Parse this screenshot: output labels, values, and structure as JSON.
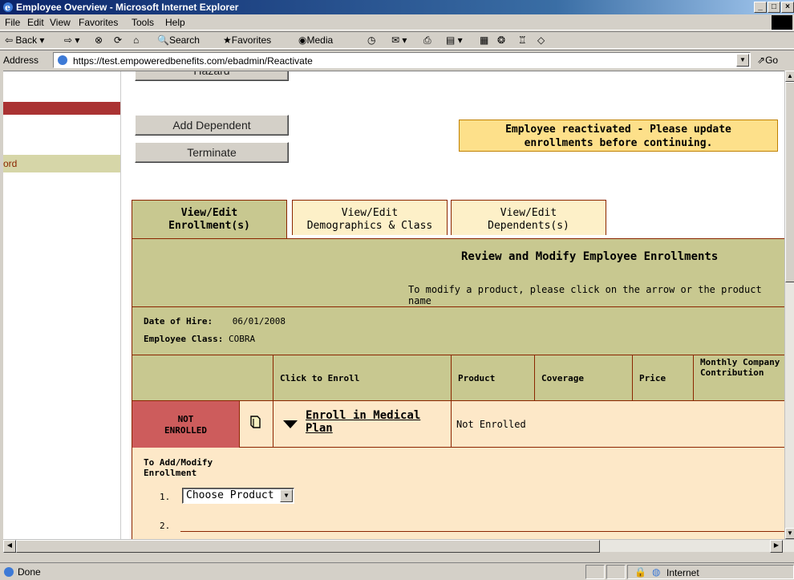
{
  "window": {
    "title": "Employee Overview - Microsoft Internet Explorer",
    "controls": [
      "_",
      "□",
      "×"
    ]
  },
  "menu": [
    "File",
    "Edit",
    "View",
    "Favorites",
    "Tools",
    "Help"
  ],
  "toolbar": {
    "back": "Back",
    "search": "Search",
    "favorites": "Favorites",
    "media": "Media"
  },
  "address": {
    "label": "Address",
    "url": "https://test.empoweredbenefits.com/ebadmin/Reactivate",
    "go": "Go"
  },
  "sidebar": {
    "item_partial": "ord"
  },
  "buttons": {
    "top_partial": "Hazard",
    "add_dependent": "Add Dependent",
    "terminate": "Terminate"
  },
  "notice": {
    "line1": "Employee reactivated - Please update",
    "line2": "enrollments before continuing."
  },
  "tabs": [
    {
      "line1": "View/Edit",
      "line2": "Enrollment(s)"
    },
    {
      "line1": "View/Edit",
      "line2": "Demographics & Class"
    },
    {
      "line1": "View/Edit",
      "line2": "Dependents(s)"
    }
  ],
  "review": {
    "title": "Review and Modify Employee Enrollments",
    "subtitle": "To modify a product, please click on the arrow or the product name"
  },
  "employee": {
    "hire_label": "Date of Hire:",
    "hire_value": "06/01/2008",
    "class_label": "Employee Class:",
    "class_value": "COBRA"
  },
  "table": {
    "headers": [
      "Click to Enroll",
      "Product",
      "Coverage",
      "Price",
      "Monthly Company Contribution"
    ],
    "row": {
      "status_line1": "NOT",
      "status_line2": "ENROLLED",
      "enroll_line1": "Enroll in Medical",
      "enroll_line2": "Plan",
      "product": "Not Enrolled"
    }
  },
  "add_modify": {
    "line1": "To Add/Modify",
    "line2": "Enrollment",
    "step1": "1.",
    "step2": "2.",
    "select_value": "Choose Product"
  },
  "statusbar": {
    "text": "Done",
    "zone": "Internet"
  }
}
